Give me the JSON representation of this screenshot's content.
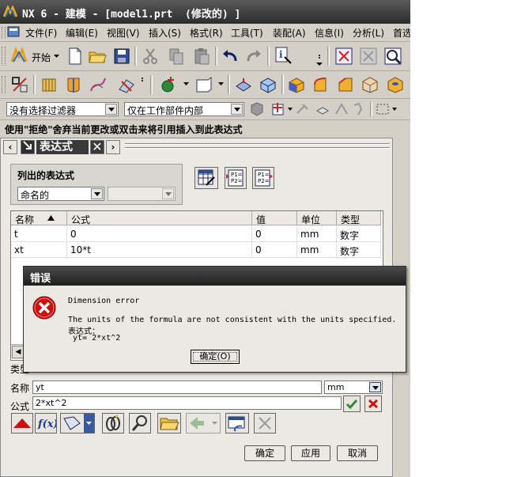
{
  "window": {
    "title": "NX 6 - 建模 - [model1.prt  (修改的) ]"
  },
  "menubar": {
    "items": [
      "文件(F)",
      "编辑(E)",
      "视图(V)",
      "插入(S)",
      "格式(R)",
      "工具(T)",
      "装配(A)",
      "信息(I)",
      "分析(L)",
      "首选"
    ]
  },
  "toolbar1": {
    "start_label": "开始"
  },
  "selection_bar": {
    "filter_value": "没有选择过滤器",
    "scope_value": "仅在工作部件内部"
  },
  "prompt": "使用\"拒绝\"舍弃当前更改或双击来将引用插入到此表达式",
  "panel": {
    "tab_title": "表达式"
  },
  "listed": {
    "group_label": "列出的表达式",
    "filter_value": "命名的"
  },
  "table": {
    "columns": [
      "名称",
      "公式",
      "值",
      "单位",
      "类型"
    ],
    "rows": [
      {
        "name": "t",
        "formula": "0",
        "value": "0",
        "unit": "mm",
        "type": "数字"
      },
      {
        "name": "xt",
        "formula": "10*t",
        "value": "0",
        "unit": "mm",
        "type": "数字"
      }
    ]
  },
  "editor": {
    "type_label": "类型",
    "name_label": "名称",
    "name_value": "yt",
    "unit_value": "mm",
    "formula_label": "公式",
    "formula_value": "2*xt^2"
  },
  "buttons": {
    "ok": "确定",
    "apply": "应用",
    "cancel": "取消"
  },
  "error_dialog": {
    "title": "错误",
    "line1": "Dimension error",
    "line2": "The units of the formula are not consistent with the units specified.",
    "line3": "表达式：",
    "line4": " yt= 2*xt^2",
    "ok_label": "确定(O)"
  },
  "colors": {
    "titlebar": "#2c2c2c",
    "error_icon": "#cc1010",
    "accept_green": "#2e8b2e",
    "reject_red": "#cc1111"
  }
}
